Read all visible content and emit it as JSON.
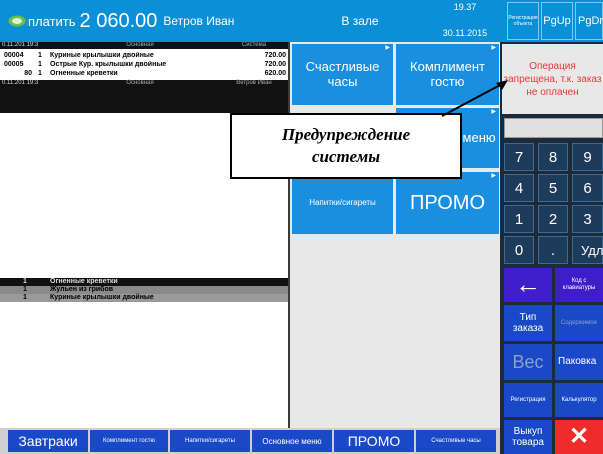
{
  "header": {
    "pay_label": "платить",
    "total": "2 060.00",
    "waiter": "Ветров Иван",
    "hall": "В зале",
    "time": "19.37",
    "date": "30.11.2015",
    "small_button": "Регистрация объекта",
    "pgup": "PgUp",
    "pgdn": "PgDn",
    "colors": {
      "bar": "#0b8fd6",
      "text": "#ffffff"
    }
  },
  "order": {
    "top_bar": {
      "date": "0.11.201 19:3",
      "section": "Основная",
      "user": "Система"
    },
    "items": [
      {
        "code": "00004",
        "qty": "1",
        "name": "Куриные крылышки двойные",
        "price": "720.00"
      },
      {
        "code": "00005",
        "qty": "1",
        "name": "Острые Кур. крылышки двойные",
        "price": "720.00"
      },
      {
        "code": "80",
        "qty": "1",
        "name": "Огненные креветки",
        "price": "620.00"
      }
    ],
    "second_bar": {
      "date": "0.11.201 19:3",
      "section": "Основная",
      "user": "Ветров Иван"
    },
    "recent": [
      {
        "qty": "1",
        "name": "Огненные креветки",
        "selected": true
      },
      {
        "qty": "1",
        "name": "Жульен из грибов",
        "selected": false
      },
      {
        "qty": "1",
        "name": "Куриные крылышки двойные",
        "selected": false
      }
    ]
  },
  "tiles": {
    "happy_hours": "Счастливые часы",
    "compliment": "Комплимент гостю",
    "main_menu": "Основное меню",
    "drinks": "Напитки/сигареты",
    "promo": "ПРОМО"
  },
  "right_panel": {
    "warning": "Операция запрещена, т.к. заказ не оплачен",
    "keys": [
      "7",
      "8",
      "9",
      "4",
      "5",
      "6",
      "1",
      "2",
      "3",
      "0",
      ".",
      "Удл"
    ],
    "back_icon": "arrow-left-icon",
    "keyboard_code": "Код с клавиатуры",
    "order_type": "Тип заказа",
    "contents": "Содержимое",
    "weight": "Вес",
    "package": "Паковка",
    "registration": "Регистрация",
    "calculator": "Калькулятор",
    "buyout": "Выкуп товара",
    "close_icon": "close-icon",
    "colors": {
      "bg": "#1c2a3a",
      "key": "#1d3c5c",
      "purple": "#3e1ec8",
      "red": "#ef2b2b",
      "warning": "#e53935"
    }
  },
  "bottom": {
    "breakfasts": "Завтраки",
    "compliment": "Комплимент гостю",
    "drinks": "Напитки/сигареты",
    "main_menu": "Основное меню",
    "promo": "ПРОМО",
    "happy_hours": "Счастливые часы",
    "button_color": "#1a49c8"
  },
  "callout": {
    "line1": "Предупреждение",
    "line2": "системы"
  }
}
